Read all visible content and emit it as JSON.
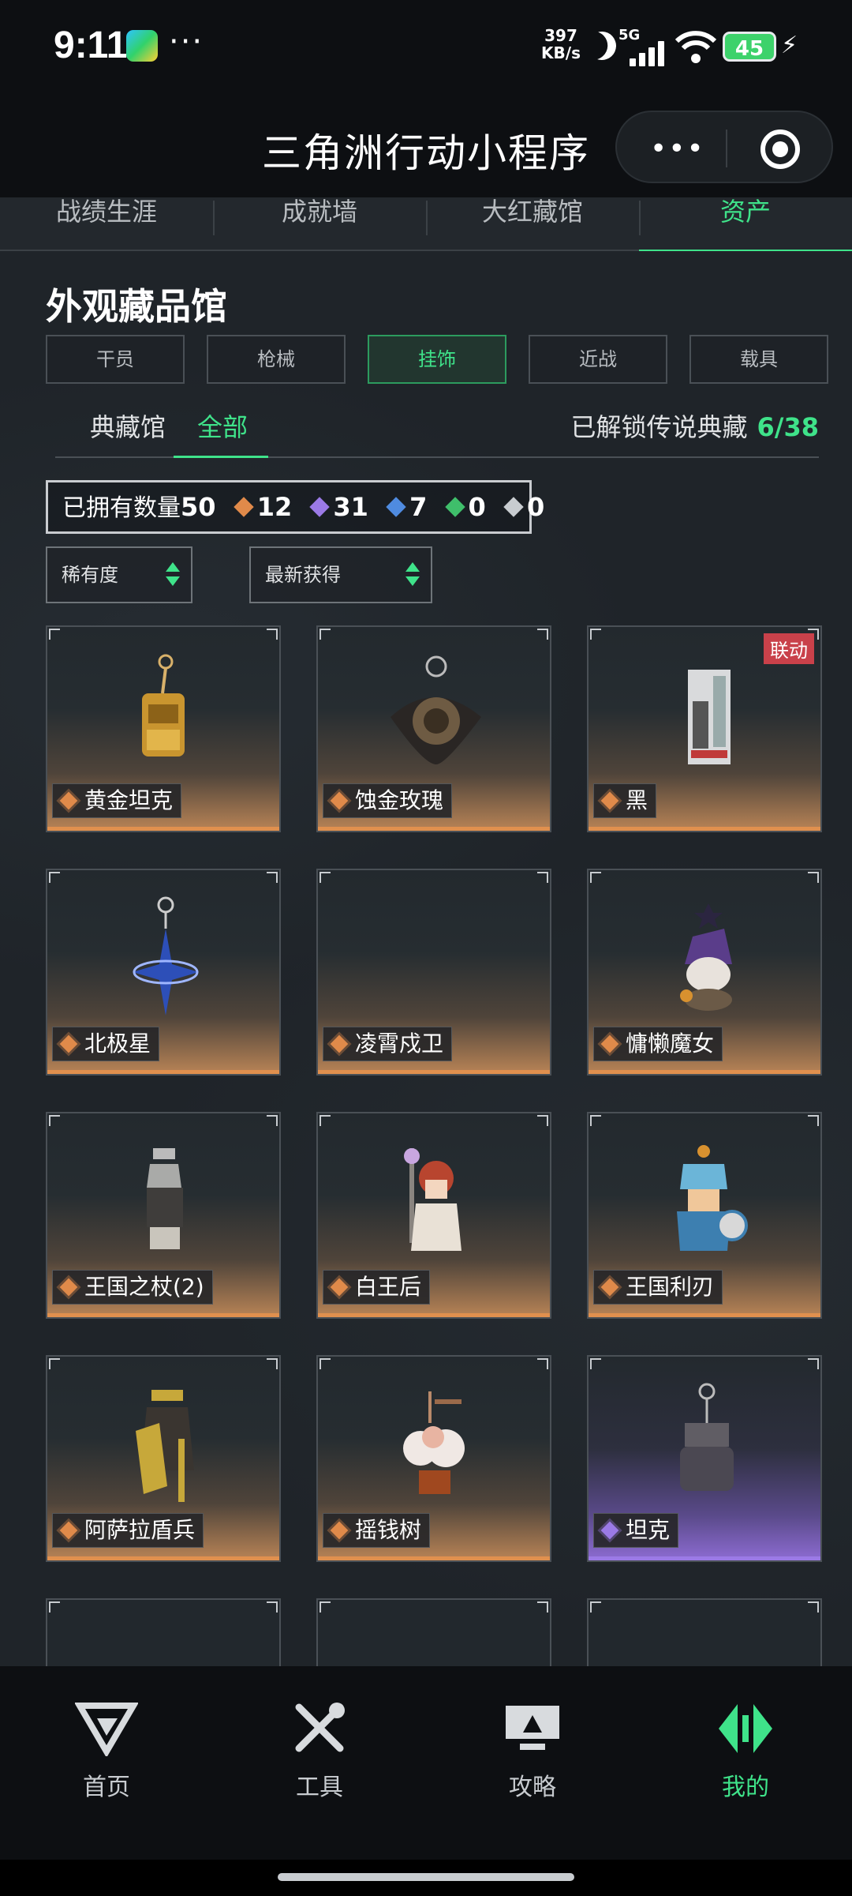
{
  "status_bar": {
    "time": "9:11",
    "dots": "···",
    "net_speed_value": "397",
    "net_speed_unit": "KB/s",
    "network": "5G",
    "battery": "45",
    "colors": {
      "battery": "#3dd26b"
    }
  },
  "header": {
    "title": "三角洲行动小程序",
    "more_glyph": "•••"
  },
  "tabs": [
    {
      "label": "战绩生涯"
    },
    {
      "label": "成就墙"
    },
    {
      "label": "大红藏馆"
    },
    {
      "label": "资产"
    }
  ],
  "section": {
    "title": "外观藏品馆",
    "categories": [
      {
        "label": "干员"
      },
      {
        "label": "枪械"
      },
      {
        "label": "挂饰"
      },
      {
        "label": "近战"
      },
      {
        "label": "载具"
      }
    ],
    "active_category": "挂饰",
    "subtabs": [
      {
        "label": "典藏馆"
      },
      {
        "label": "全部"
      }
    ],
    "active_subtab": "全部",
    "unlock_label": "已解锁传说典藏",
    "unlock_count": "6/38"
  },
  "owned": {
    "label": "已拥有数量",
    "total": "50",
    "counts": [
      {
        "value": "12",
        "color": "#e08a4a"
      },
      {
        "value": "31",
        "color": "#9b7ae6"
      },
      {
        "value": "7",
        "color": "#4f8be0"
      },
      {
        "value": "0",
        "color": "#3fbf6b"
      },
      {
        "value": "0",
        "color": "#c8ccd0"
      }
    ]
  },
  "filters": [
    {
      "label": "稀有度"
    },
    {
      "label": "最新获得"
    }
  ],
  "items": [
    {
      "name": "黄金坦克",
      "rarity": "orange"
    },
    {
      "name": "蚀金玫瑰",
      "rarity": "orange"
    },
    {
      "name": "黑",
      "rarity": "orange",
      "badge": "联动"
    },
    {
      "name": "北极星",
      "rarity": "orange"
    },
    {
      "name": "凌霄戍卫",
      "rarity": "orange"
    },
    {
      "name": "慵懒魔女",
      "rarity": "orange"
    },
    {
      "name": "王国之杖(2)",
      "rarity": "orange"
    },
    {
      "name": "白王后",
      "rarity": "orange"
    },
    {
      "name": "王国利刃",
      "rarity": "orange"
    },
    {
      "name": "阿萨拉盾兵",
      "rarity": "orange"
    },
    {
      "name": "摇钱树",
      "rarity": "orange"
    },
    {
      "name": "坦克",
      "rarity": "purple"
    }
  ],
  "bottom_nav": [
    {
      "label": "首页",
      "icon": "home-logo-icon"
    },
    {
      "label": "工具",
      "icon": "tools-icon"
    },
    {
      "label": "攻略",
      "icon": "guide-monitor-icon"
    },
    {
      "label": "我的",
      "icon": "profile-logo-icon"
    }
  ],
  "active_nav": "我的"
}
